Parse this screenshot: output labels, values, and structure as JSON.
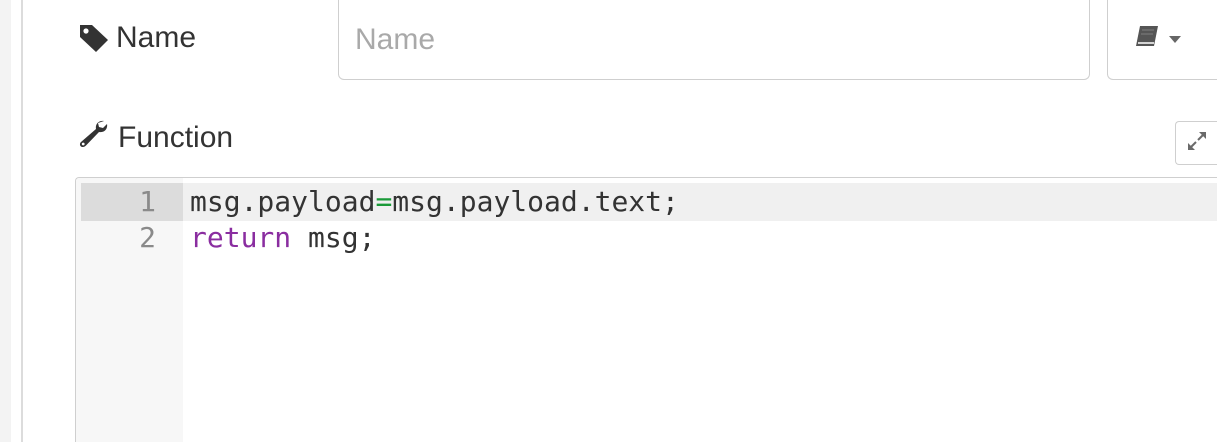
{
  "name_row": {
    "label": "Name",
    "input_value": "",
    "input_placeholder": "Name",
    "library_button_icon": "book-icon",
    "library_caret_icon": "caret-down-icon"
  },
  "function_row": {
    "label": "Function",
    "expand_icon": "expand-icon"
  },
  "editor": {
    "lines": [
      {
        "number": "1",
        "parts": [
          "msg.payload",
          "=",
          "msg.payload.text;"
        ]
      },
      {
        "number": "2",
        "parts": [
          "return",
          " msg;"
        ]
      }
    ]
  },
  "colors": {
    "operator": "#1a9a38",
    "keyword": "#8a2da0",
    "text": "#333333",
    "gutter_active": "#dcdcdc"
  }
}
